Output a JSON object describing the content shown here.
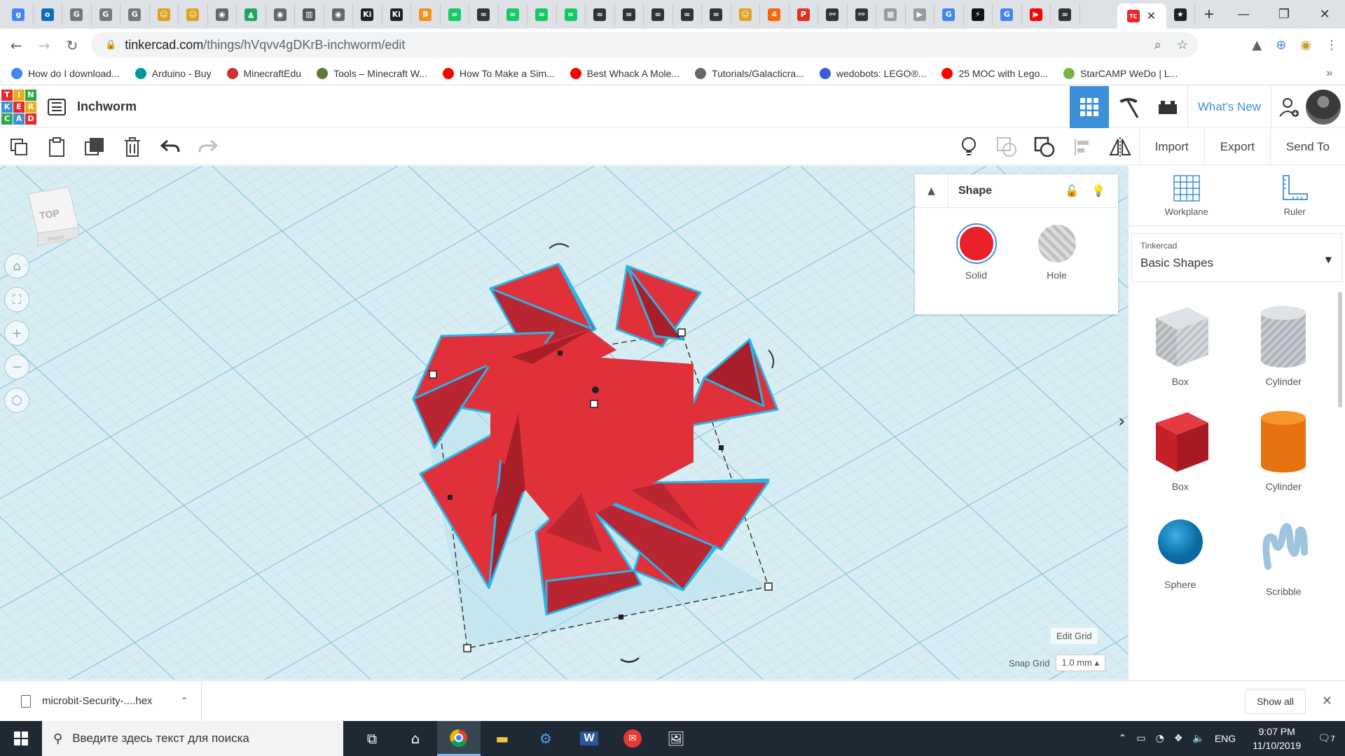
{
  "browser": {
    "tabs": [
      {
        "icon": "g",
        "color": "#4285f4"
      },
      {
        "icon": "o",
        "color": "#0f6cbd"
      },
      {
        "icon": "G",
        "color": "#777777"
      },
      {
        "icon": "G",
        "color": "#777777"
      },
      {
        "icon": "G",
        "color": "#777777"
      },
      {
        "icon": "☺",
        "color": "#e0a020"
      },
      {
        "icon": "☺",
        "color": "#e0a020"
      },
      {
        "icon": "◉",
        "color": "#666666"
      },
      {
        "icon": "▲",
        "color": "#1fa463"
      },
      {
        "icon": "◉",
        "color": "#666666"
      },
      {
        "icon": "▥",
        "color": "#555555"
      },
      {
        "icon": "◉",
        "color": "#666666"
      },
      {
        "icon": "Ki",
        "color": "#222222"
      },
      {
        "icon": "Ki",
        "color": "#222222"
      },
      {
        "icon": "B",
        "color": "#f7931a"
      },
      {
        "icon": "∞",
        "color": "#17c964"
      },
      {
        "icon": "∞",
        "color": "#333333"
      },
      {
        "icon": "∞",
        "color": "#17c964"
      },
      {
        "icon": "∞",
        "color": "#17c964"
      },
      {
        "icon": "∞",
        "color": "#17c964"
      },
      {
        "icon": "∞",
        "color": "#333333"
      },
      {
        "icon": "∞",
        "color": "#333333"
      },
      {
        "icon": "∞",
        "color": "#333333"
      },
      {
        "icon": "∞",
        "color": "#333333"
      },
      {
        "icon": "∞",
        "color": "#333333"
      },
      {
        "icon": "☺",
        "color": "#e0a020"
      },
      {
        "icon": "4",
        "color": "#ff6600"
      },
      {
        "icon": "P",
        "color": "#e03020"
      },
      {
        "icon": "⚯",
        "color": "#333333"
      },
      {
        "icon": "⚯",
        "color": "#333333"
      },
      {
        "icon": "▦",
        "color": "#999999"
      },
      {
        "icon": "▶",
        "color": "#999999"
      },
      {
        "icon": "G",
        "color": "#4285f4"
      },
      {
        "icon": "⚡",
        "color": "#111111"
      },
      {
        "icon": "G",
        "color": "#4285f4"
      },
      {
        "icon": "▶",
        "color": "#ff0000"
      },
      {
        "icon": "∞",
        "color": "#333333"
      }
    ],
    "active_tab_close": "✕",
    "after_active_tab": {
      "icon": "★",
      "color": "#222222"
    },
    "new_tab": "+",
    "window_controls": {
      "minimize": "—",
      "maximize": "❐",
      "close": "✕"
    },
    "url_host": "tinkercad.com",
    "url_path": "/things/hVqvv4gDKrB-inchworm/edit",
    "bookmarks": [
      {
        "label": "How do I download...",
        "color": "#4285f4"
      },
      {
        "label": "Arduino - Buy",
        "color": "#00979d"
      },
      {
        "label": "MinecraftEdu",
        "color": "#d0302f"
      },
      {
        "label": "Tools – Minecraft W...",
        "color": "#5b7a36"
      },
      {
        "label": "How To Make a Sim...",
        "color": "#ff0000"
      },
      {
        "label": "Best Whack A Mole...",
        "color": "#ff0000"
      },
      {
        "label": "Tutorials/Galacticra...",
        "color": "#666666"
      },
      {
        "label": "wedobots: LEGO®...",
        "color": "#3b5bdb"
      },
      {
        "label": "25 MOC with Lego...",
        "color": "#ff0000"
      },
      {
        "label": "StarCAMP WeDo | L...",
        "color": "#7cb342"
      }
    ],
    "bookmarks_more": "»"
  },
  "tinkercad": {
    "logo_letters": [
      "T",
      "I",
      "N",
      "K",
      "E",
      "R",
      "C",
      "A",
      "D"
    ],
    "logo_colors": [
      "#e8282b",
      "#f0a81c",
      "#30a948",
      "#3c8fd8",
      "#e8282b",
      "#f0a81c",
      "#30a948",
      "#3c8fd8",
      "#e8282b"
    ],
    "design_title": "Inchworm",
    "whats_new": "What's New",
    "toolbar": {
      "import": "Import",
      "export": "Export",
      "send_to": "Send To"
    },
    "viewcube": {
      "top": "TOP",
      "front": "FRONT"
    },
    "inspector": {
      "title": "Shape",
      "solid": "Solid",
      "hole": "Hole"
    },
    "edit_grid": "Edit Grid",
    "snap_grid": "Snap Grid",
    "snap_value": "1.0 mm ▴",
    "panel": {
      "workplane": "Workplane",
      "ruler": "Ruler",
      "library_category": "Tinkercad",
      "library_name": "Basic Shapes",
      "shapes": [
        {
          "label": "Box",
          "kind": "box-hole"
        },
        {
          "label": "Cylinder",
          "kind": "cylinder-hole"
        },
        {
          "label": "Box",
          "kind": "box-solid"
        },
        {
          "label": "Cylinder",
          "kind": "cylinder-solid"
        },
        {
          "label": "Sphere",
          "kind": "sphere"
        },
        {
          "label": "Scribble",
          "kind": "scribble"
        }
      ]
    },
    "colors": {
      "accent": "#3c8fd8",
      "shape_red": "#e0313b",
      "selection": "#29b5e8"
    }
  },
  "downloads": {
    "file": "microbit-Security-....hex",
    "show_all": "Show all"
  },
  "taskbar": {
    "search_placeholder": "Введите здесь текст для поиска",
    "lang": "ENG",
    "time": "9:07 PM",
    "date": "11/10/2019",
    "notifications": "7"
  }
}
